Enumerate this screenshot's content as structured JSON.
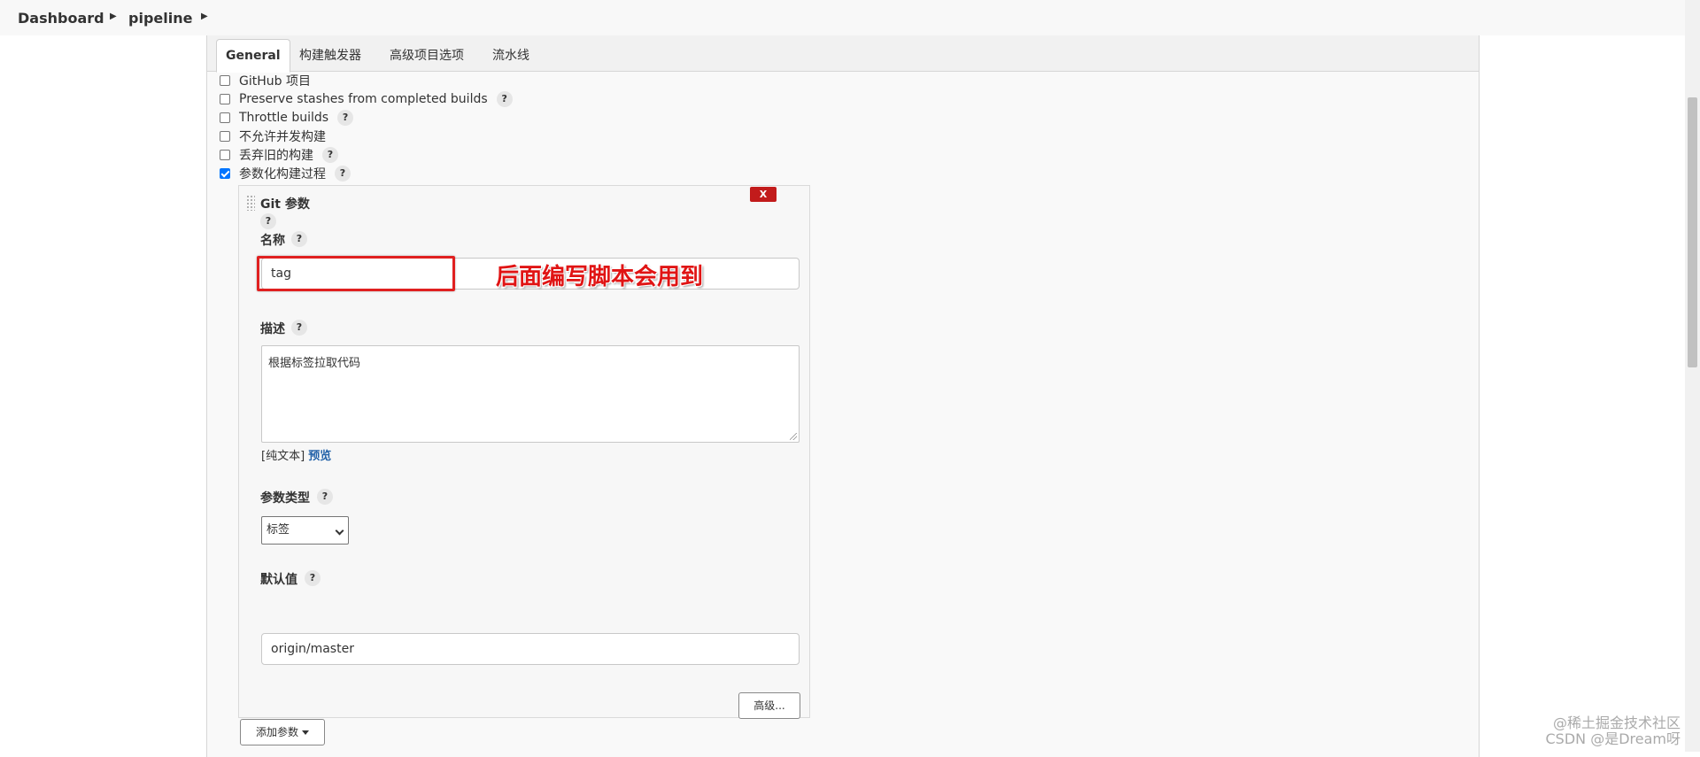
{
  "breadcrumb": {
    "items": [
      "Dashboard",
      "pipeline"
    ]
  },
  "tabs": [
    {
      "label": "General",
      "active": true
    },
    {
      "label": "构建触发器"
    },
    {
      "label": "高级项目选项"
    },
    {
      "label": "流水线"
    }
  ],
  "options": [
    {
      "label": "GitHub 项目",
      "checked": false,
      "help": false
    },
    {
      "label": "Preserve stashes from completed builds",
      "checked": false,
      "help": true
    },
    {
      "label": "Throttle builds",
      "checked": false,
      "help": true
    },
    {
      "label": "不允许并发构建",
      "checked": false,
      "help": false
    },
    {
      "label": "丢弃旧的构建",
      "checked": false,
      "help": true
    },
    {
      "label": "参数化构建过程",
      "checked": true,
      "help": true
    }
  ],
  "help_symbol": "?",
  "git_param": {
    "title": "Git 参数",
    "delete_label": "X",
    "name_label": "名称",
    "name_value": "tag",
    "desc_label": "描述",
    "desc_value": "根据标签拉取代码",
    "preview_prefix": "[纯文本]",
    "preview_link": "预览",
    "type_label": "参数类型",
    "type_value": "标签",
    "default_label": "默认值",
    "default_value": "origin/master",
    "advanced_label": "高级..."
  },
  "add_param_label": "添加参数",
  "annotation_text": "后面编写脚本会用到",
  "watermarks": [
    "@稀土掘金技术社区",
    "CSDN @是Dream呀"
  ],
  "colors": {
    "accent": "#0075ff",
    "delete": "#c21b1b",
    "annotation": "#e01414",
    "link": "#2463a9"
  }
}
